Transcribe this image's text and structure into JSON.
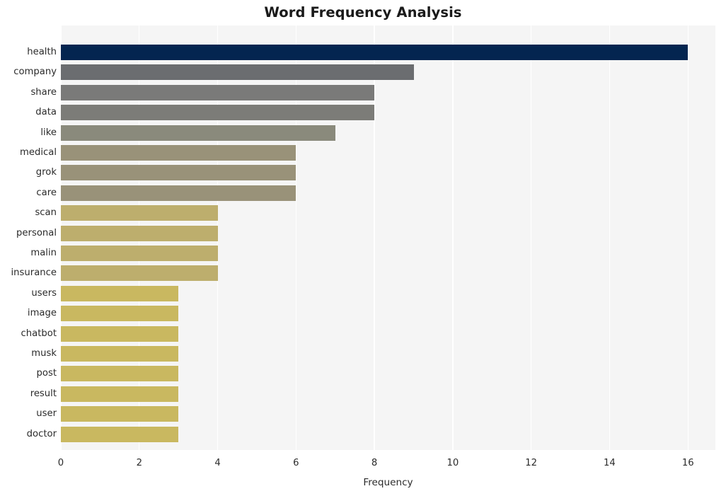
{
  "chart_data": {
    "type": "bar",
    "orientation": "horizontal",
    "title": "Word Frequency Analysis",
    "xlabel": "Frequency",
    "ylabel": "",
    "categories": [
      "health",
      "company",
      "share",
      "data",
      "like",
      "medical",
      "grok",
      "care",
      "scan",
      "personal",
      "malin",
      "insurance",
      "users",
      "image",
      "chatbot",
      "musk",
      "post",
      "result",
      "user",
      "doctor"
    ],
    "values": [
      16,
      9,
      8,
      8,
      7,
      6,
      6,
      6,
      4,
      4,
      4,
      4,
      3,
      3,
      3,
      3,
      3,
      3,
      3,
      3
    ],
    "bar_colors": [
      "#042550",
      "#6b6d70",
      "#7a7a79",
      "#7c7c78",
      "#8a8a7c",
      "#999279",
      "#999279",
      "#999279",
      "#bdae6d",
      "#bdae6d",
      "#bdae6d",
      "#bdae6d",
      "#c9b860",
      "#c9b860",
      "#c9b860",
      "#c9b860",
      "#c9b860",
      "#c9b860",
      "#c9b860",
      "#c9b860"
    ],
    "xlim": [
      0,
      16.7
    ],
    "xticks": [
      0,
      2,
      4,
      6,
      8,
      10,
      12,
      14,
      16
    ],
    "xtick_labels": [
      "0",
      "2",
      "4",
      "6",
      "8",
      "10",
      "12",
      "14",
      "16"
    ],
    "grid": true,
    "grid_axis": "x",
    "grid_color": "#ffffff",
    "plot_background": "#f5f5f5",
    "figure_background": "#ffffff",
    "legend": null
  }
}
